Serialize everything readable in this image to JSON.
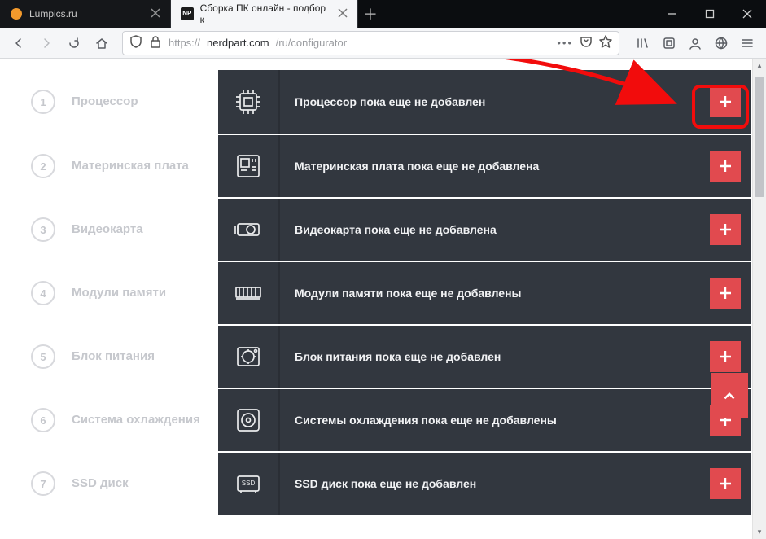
{
  "window": {
    "tabs": [
      {
        "title": "Lumpics.ru",
        "active": false,
        "favicon": "orange"
      },
      {
        "title": "Сборка ПК онлайн - подбор к",
        "active": true,
        "favicon": "np"
      }
    ],
    "url_prefix": "https://",
    "url_host": "nerdpart.com",
    "url_path": "/ru/configurator"
  },
  "rows": [
    {
      "num": "1",
      "label": "Процессор",
      "msg": "Процессор пока еще не добавлен",
      "icon": "cpu"
    },
    {
      "num": "2",
      "label": "Материнская плата",
      "msg": "Материнская плата пока еще не добавлена",
      "icon": "mobo"
    },
    {
      "num": "3",
      "label": "Видеокарта",
      "msg": "Видеокарта пока еще не добавлена",
      "icon": "gpu"
    },
    {
      "num": "4",
      "label": "Модули памяти",
      "msg": "Модули памяти пока еще не добавлены",
      "icon": "ram"
    },
    {
      "num": "5",
      "label": "Блок питания",
      "msg": "Блок питания пока еще не добавлен",
      "icon": "psu"
    },
    {
      "num": "6",
      "label": "Система охлаждения",
      "msg": "Системы охлаждения пока еще не добавлены",
      "icon": "fan"
    },
    {
      "num": "7",
      "label": "SSD диск",
      "msg": "SSD диск пока еще не добавлен",
      "icon": "ssd"
    }
  ],
  "colors": {
    "accent": "#e14a4f",
    "panel": "#32373f"
  }
}
